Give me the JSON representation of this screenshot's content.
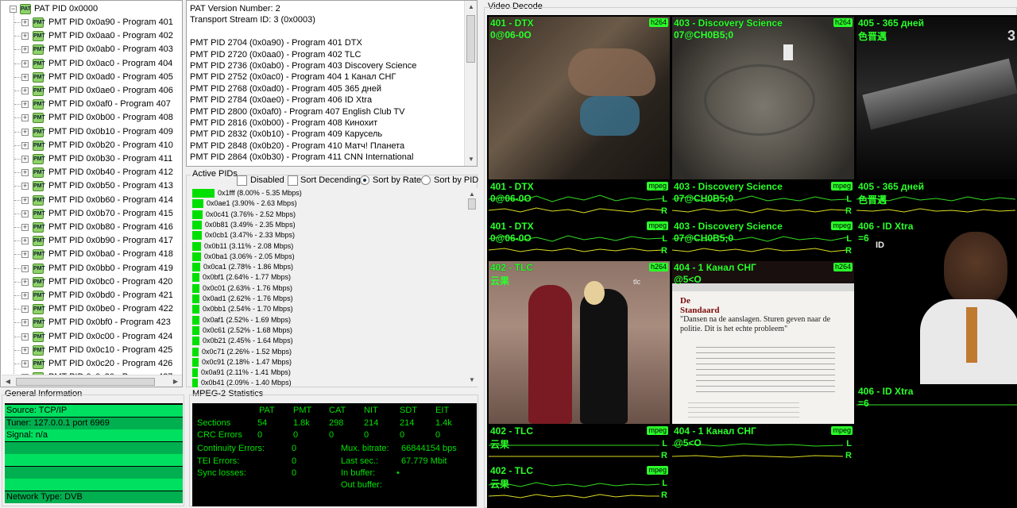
{
  "tree": {
    "root": "PAT PID 0x0000",
    "items": [
      "PMT PID 0x0a90 - Program 401",
      "PMT PID 0x0aa0 - Program 402",
      "PMT PID 0x0ab0 - Program 403",
      "PMT PID 0x0ac0 - Program 404",
      "PMT PID 0x0ad0 - Program 405",
      "PMT PID 0x0ae0 - Program 406",
      "PMT PID 0x0af0 - Program 407",
      "PMT PID 0x0b00 - Program 408",
      "PMT PID 0x0b10 - Program 409",
      "PMT PID 0x0b20 - Program 410",
      "PMT PID 0x0b30 - Program 411",
      "PMT PID 0x0b40 - Program 412",
      "PMT PID 0x0b50 - Program 413",
      "PMT PID 0x0b60 - Program 414",
      "PMT PID 0x0b70 - Program 415",
      "PMT PID 0x0b80 - Program 416",
      "PMT PID 0x0b90 - Program 417",
      "PMT PID 0x0ba0 - Program 418",
      "PMT PID 0x0bb0 - Program 419",
      "PMT PID 0x0bc0 - Program 420",
      "PMT PID 0x0bd0 - Program 421",
      "PMT PID 0x0be0 - Program 422",
      "PMT PID 0x0bf0 - Program 423",
      "PMT PID 0x0c00 - Program 424",
      "PMT PID 0x0c10 - Program 425",
      "PMT PID 0x0c20 - Program 426",
      "PMT PID 0x0c30 - Program 427"
    ]
  },
  "pat_info": {
    "lines": [
      "PAT Version Number: 2",
      "Transport Stream ID: 3 (0x0003)",
      "",
      "PMT PID 2704 (0x0a90) - Program 401 DTX",
      "PMT PID 2720 (0x0aa0) - Program 402 TLC",
      "PMT PID 2736 (0x0ab0) - Program 403 Discovery Science",
      "PMT PID 2752 (0x0ac0) - Program 404 1 Канал СНГ",
      "PMT PID 2768 (0x0ad0) - Program 405 365 дней",
      "PMT PID 2784 (0x0ae0) - Program 406 ID Xtra",
      "PMT PID 2800 (0x0af0) - Program 407 English Club TV",
      "PMT PID 2816 (0x0b00) - Program 408 Кинохит",
      "PMT PID 2832 (0x0b10) - Program 409 Карусель",
      "PMT PID 2848 (0x0b20) - Program 410 Матч! Планета",
      "PMT PID 2864 (0x0b30) - Program 411 CNN International"
    ]
  },
  "active_pids": {
    "title": "Active PIDs",
    "disabled_label": "Disabled",
    "sort_desc_label": "Sort Decending",
    "sort_rate_label": "Sort by Rate",
    "sort_pid_label": "Sort by PID",
    "sort_mode": "rate",
    "rows": [
      {
        "text": "0x1fff (8.00% - 5.35 Mbps)",
        "pct": 8.0
      },
      {
        "text": "0x0ae1 (3.90% - 2.63 Mbps)",
        "pct": 3.9
      },
      {
        "text": "0x0c41 (3.76% - 2.52 Mbps)",
        "pct": 3.76
      },
      {
        "text": "0x0b81 (3.49% - 2.35 Mbps)",
        "pct": 3.49
      },
      {
        "text": "0x0cb1 (3.47% - 2.33 Mbps)",
        "pct": 3.47
      },
      {
        "text": "0x0b11 (3.11% - 2.08 Mbps)",
        "pct": 3.11
      },
      {
        "text": "0x0ba1 (3.06% - 2.05 Mbps)",
        "pct": 3.06
      },
      {
        "text": "0x0ca1 (2.78% - 1.86 Mbps)",
        "pct": 2.78
      },
      {
        "text": "0x0bf1 (2.64% - 1.77 Mbps)",
        "pct": 2.64
      },
      {
        "text": "0x0c01 (2.63% - 1.76 Mbps)",
        "pct": 2.63
      },
      {
        "text": "0x0ad1 (2.62% - 1.76 Mbps)",
        "pct": 2.62
      },
      {
        "text": "0x0bb1 (2.54% - 1.70 Mbps)",
        "pct": 2.54
      },
      {
        "text": "0x0af1 (2.52% - 1.69 Mbps)",
        "pct": 2.52
      },
      {
        "text": "0x0c61 (2.52% - 1.68 Mbps)",
        "pct": 2.52
      },
      {
        "text": "0x0b21 (2.45% - 1.64 Mbps)",
        "pct": 2.45
      },
      {
        "text": "0x0c71 (2.26% - 1.52 Mbps)",
        "pct": 2.26
      },
      {
        "text": "0x0c91 (2.18% - 1.47 Mbps)",
        "pct": 2.18
      },
      {
        "text": "0x0a91 (2.11% - 1.41 Mbps)",
        "pct": 2.11
      },
      {
        "text": "0x0b41 (2.09% - 1.40 Mbps)",
        "pct": 2.09
      }
    ]
  },
  "general_info": {
    "title": "General Information",
    "rows": [
      "Source: TCP/IP",
      "Tuner: 127.0.0.1 port 6969",
      "Signal: n/a",
      "",
      "",
      "",
      "",
      "Network Type: DVB"
    ]
  },
  "mpeg_stats": {
    "title": "MPEG-2 Statistics",
    "columns": [
      "PAT",
      "PMT",
      "CAT",
      "NIT",
      "SDT",
      "EIT"
    ],
    "sections_label": "Sections",
    "sections": [
      "54",
      "1.8k",
      "298",
      "214",
      "214",
      "1.4k"
    ],
    "crc_label": "CRC Errors",
    "crc": [
      "0",
      "0",
      "0",
      "0",
      "0",
      "0"
    ],
    "continuity_label": "Continuity Errors:",
    "continuity": "0",
    "tei_label": "TEI Errors:",
    "tei": "0",
    "sync_label": "Sync losses:",
    "sync": "0",
    "mux_label": "Mux. bitrate:",
    "mux": "66844154 bps",
    "last_label": "Last sec.:",
    "last": "67.779 Mbit",
    "inbuf_label": "In buffer:",
    "inbuf": "•",
    "outbuf_label": "Out buffer:",
    "outbuf": ""
  },
  "video": {
    "title": "Video Decode",
    "cells": {
      "v401": {
        "title": "401 - DTX",
        "sub": "0@06-0O",
        "codec": "h264"
      },
      "v403": {
        "title": "403 - Discovery Science",
        "sub": "07@CH0B5;0",
        "codec": "h264"
      },
      "v405": {
        "title": "405 - 365 дней",
        "sub": "色晋邁",
        "codec": ""
      },
      "a401": {
        "title": "401 - DTX",
        "sub": "0@06-0O",
        "codec": "mpeg"
      },
      "a403": {
        "title": "403 - Discovery Science",
        "sub": "07@CH0B5;0",
        "codec": "mpeg"
      },
      "a405": {
        "title": "405 - 365 дней",
        "sub": "色晋邁",
        "codec": ""
      },
      "a401b": {
        "title": "401 - DTX",
        "sub": "0@06-0O",
        "codec": "mpeg"
      },
      "a403b": {
        "title": "403 - Discovery Science",
        "sub": "07@CH0B5;0",
        "codec": "mpeg"
      },
      "v406": {
        "title": "406 - ID Xtra",
        "sub": "=6",
        "codec": ""
      },
      "v402": {
        "title": "402 - TLC",
        "sub": "云果",
        "codec": "h264"
      },
      "v404": {
        "title": "404 - 1 Канал СНГ",
        "sub": "@5<O",
        "codec": "h264"
      },
      "a406": {
        "title": "406 - ID Xtra",
        "sub": "=6",
        "codec": ""
      },
      "a402": {
        "title": "402 - TLC",
        "sub": "云果",
        "codec": "mpeg"
      },
      "a404": {
        "title": "404 - 1 Канал СНГ",
        "sub": "@5<O",
        "codec": "mpeg"
      },
      "a402b": {
        "title": "402 - TLC",
        "sub": "云果",
        "codec": "mpeg"
      }
    },
    "channel_l": "L",
    "channel_r": "R",
    "news_page": {
      "brand": "De Standaard",
      "headline": "\"Dansen na de aanslagen. Sturen geven naar de politie. Dit is het echte probleem\""
    }
  }
}
